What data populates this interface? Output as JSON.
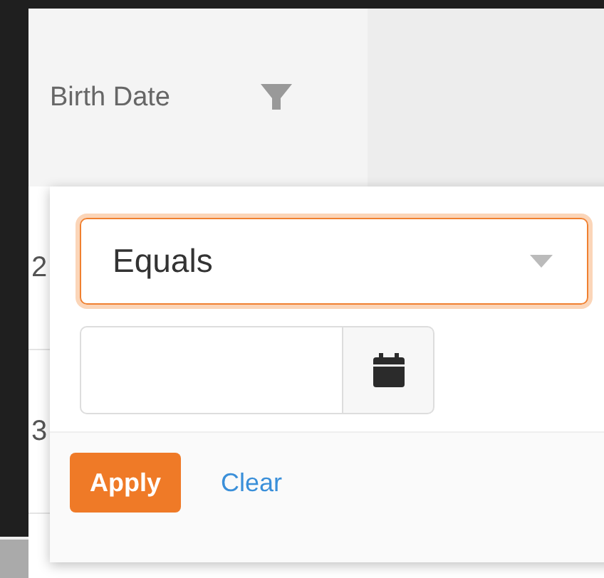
{
  "column_header": {
    "label": "Birth Date",
    "filter_active": false
  },
  "rows": [
    {
      "cell": "2"
    },
    {
      "cell": "3"
    }
  ],
  "filter_popup": {
    "operator": {
      "value": "Equals",
      "focused": true
    },
    "buttons": [
      {
        "kind": "primary",
        "label": "Apply"
      },
      {
        "kind": "link",
        "label": "Clear"
      }
    ]
  }
}
